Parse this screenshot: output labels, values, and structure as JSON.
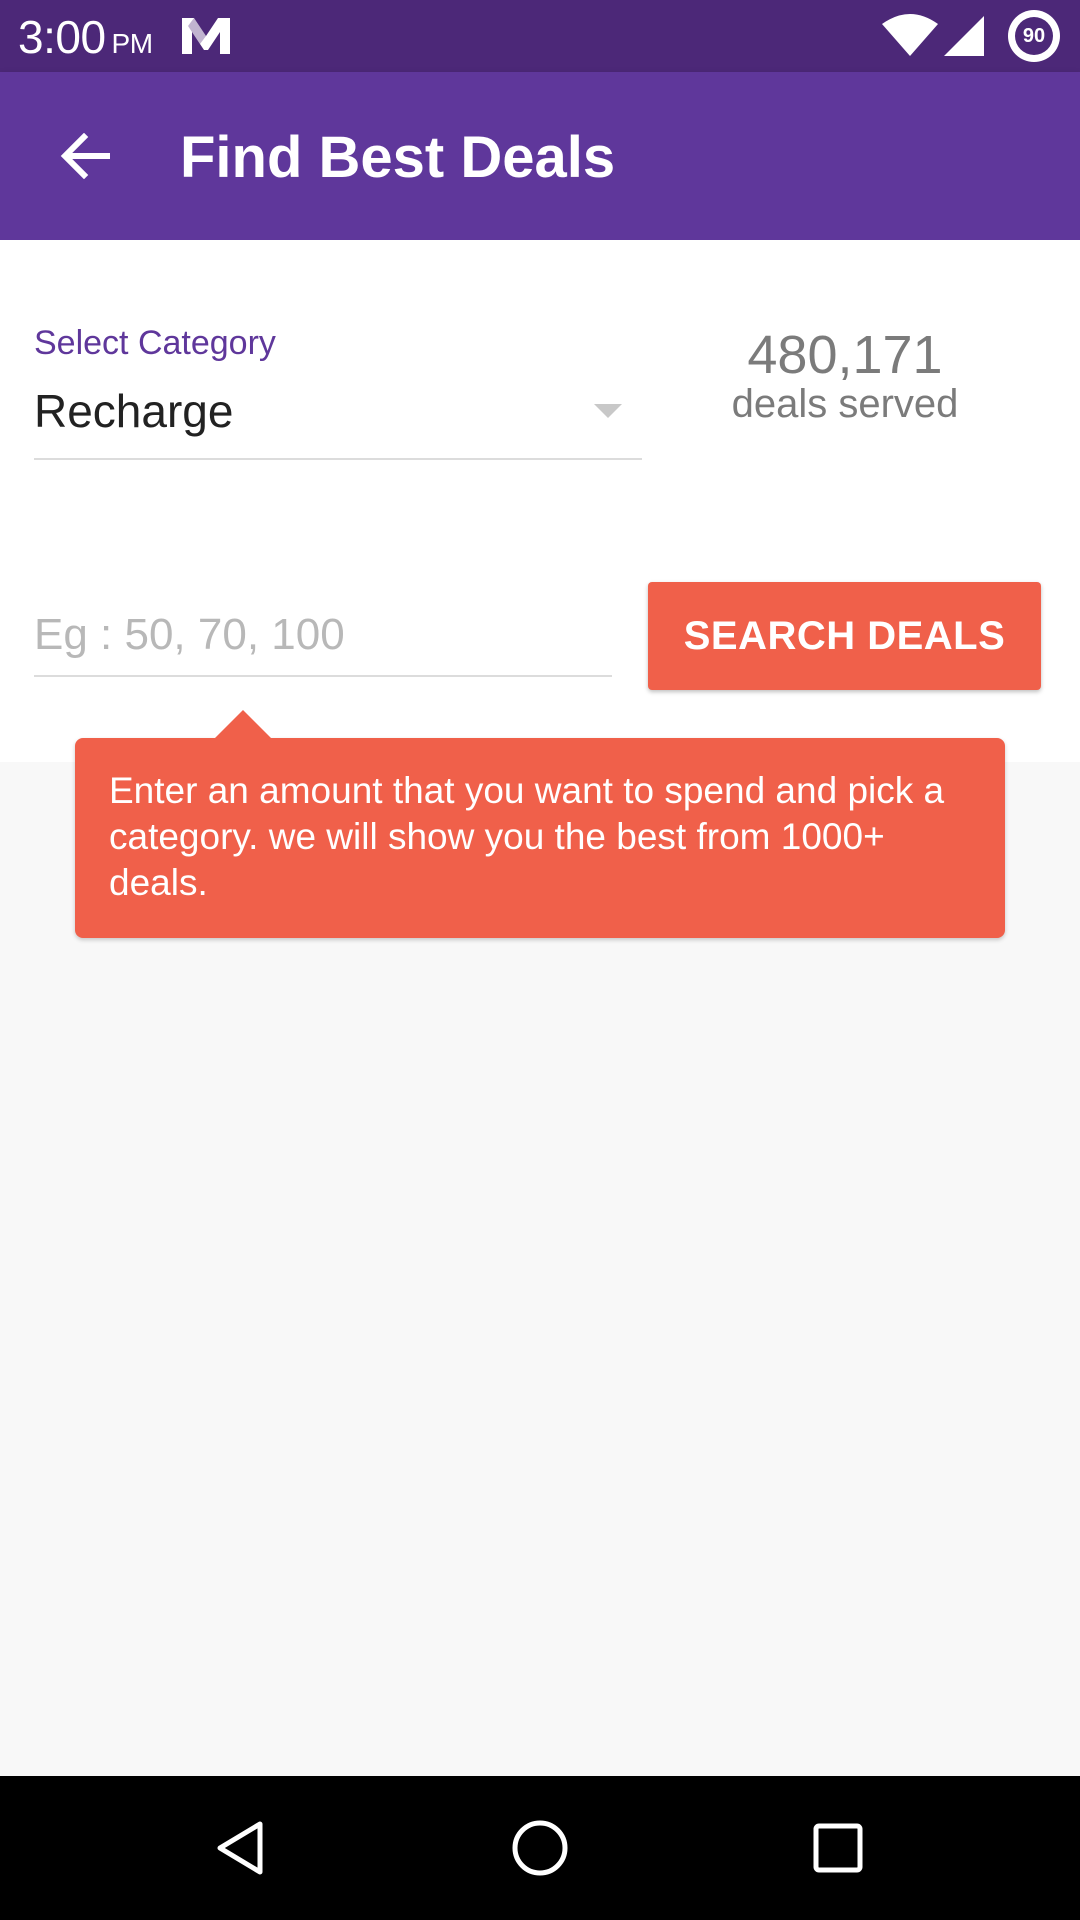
{
  "status_bar": {
    "time": "3:00",
    "ampm": "PM",
    "battery_level": "90",
    "icons": [
      "notification-icon",
      "wifi-icon",
      "signal-icon",
      "battery-icon"
    ]
  },
  "app_bar": {
    "title": "Find Best Deals",
    "back_icon": "arrow-back-icon"
  },
  "form": {
    "category_label": "Select Category",
    "category_value": "Recharge",
    "deals_count": "480,171",
    "deals_served_label": "deals served",
    "amount_placeholder": "Eg : 50, 70, 100",
    "amount_value": "",
    "search_button_label": "SEARCH DEALS"
  },
  "tooltip": {
    "text": "Enter an amount that you want to spend and pick a category. we will show you the best from 1000+ deals."
  },
  "colors": {
    "status_bar": "#4c2878",
    "app_bar": "#5f379b",
    "accent": "#f0604a",
    "label": "#5f379b"
  },
  "nav_bar": {
    "icons": [
      "nav-back-icon",
      "nav-home-icon",
      "nav-recents-icon"
    ]
  }
}
